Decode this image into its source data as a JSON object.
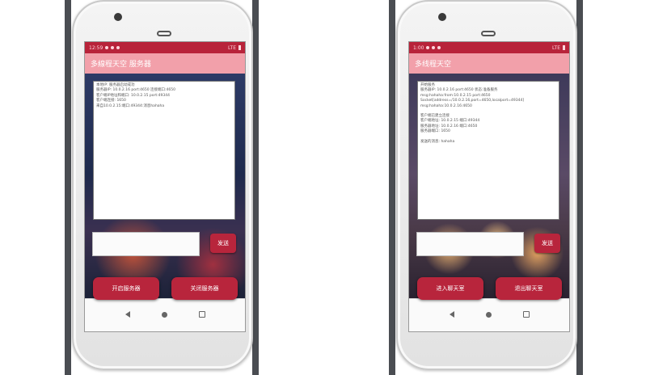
{
  "left_phone": {
    "status_time": "12:59",
    "status_network": "LTE",
    "app_title": "多線程天空 服务器",
    "log_lines": [
      "本地IP: 服务器启动成功",
      "服务器IP: 10.0.2.16 port:4650 连接端口:4650",
      "客户端IP地址和端口: 10.0.2.15 port:49344",
      "客户端连接: 1650",
      "来自10.0.2.15:端口:49344:消息hahaha"
    ],
    "send_label": "发送",
    "start_server_label": "开启服务器",
    "stop_server_label": "关闭服务器"
  },
  "right_phone": {
    "status_time": "1:00",
    "status_network": "LTE",
    "app_title": "多线程天空",
    "log_lines": [
      "开始服务",
      "服务器IP: 10.0.2.16 port:4650 状态:准备服务",
      "msg:hahaha:from:10.0.2.15 port:4650",
      "Socket[address=/10.0.2.16,port=4650,localport=49344]",
      "msg:hahaha:10.0.2.16:4650",
      "",
      "客户端已建立连接",
      "客户端地址: 10.0.2.15 端口:49344",
      "服务器地址: 10.0.2.16 端口:4650",
      "服务器端口: 1650",
      "",
      "发送的消息: hahaha"
    ],
    "send_label": "发送",
    "enter_chat_label": "进入聊天室",
    "exit_chat_label": "退出聊天室"
  }
}
